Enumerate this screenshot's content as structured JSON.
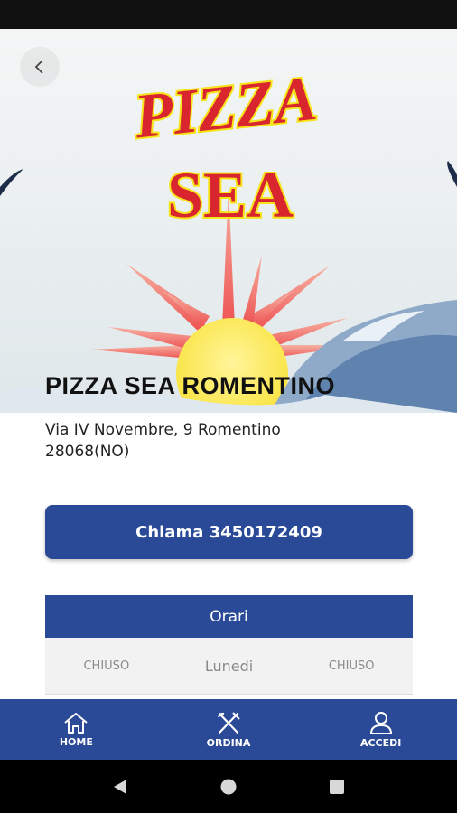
{
  "hero": {
    "logo_line1": "PIZZA",
    "logo_line2": "SEA"
  },
  "restaurant": {
    "name": "PIZZA SEA ROMENTINO",
    "address_line1": "Via IV Novembre, 9 Romentino",
    "address_line2": "28068(NO)"
  },
  "call_button": {
    "label": "Chiama 3450172409"
  },
  "hours": {
    "header": "Orari",
    "rows": [
      {
        "morning": "CHIUSO",
        "day": "Lunedi",
        "evening": "CHIUSO"
      }
    ]
  },
  "bottom_nav": {
    "items": [
      {
        "label": "HOME",
        "icon": "home-icon"
      },
      {
        "label": "ORDINA",
        "icon": "fork-knife-icon"
      },
      {
        "label": "ACCEDI",
        "icon": "user-icon"
      }
    ]
  },
  "colors": {
    "primary": "#2a4a97",
    "logo_red": "#d9262e",
    "logo_yellow": "#f7e31a",
    "sun_yellow": "#fbe94a",
    "sun_rays": "#f05a5a"
  }
}
